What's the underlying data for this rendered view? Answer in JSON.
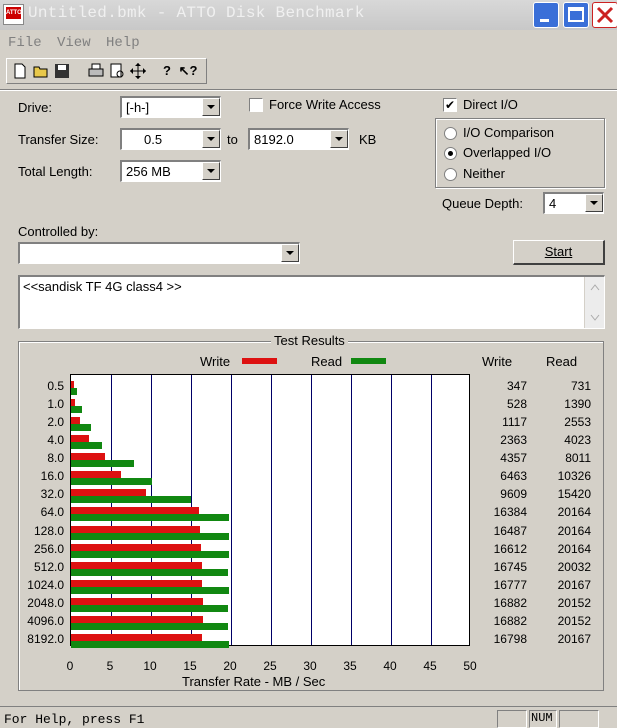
{
  "window": {
    "title": "Untitled.bmk - ATTO Disk Benchmark",
    "icon_text": "ATTO"
  },
  "menu": [
    "File",
    "View",
    "Help"
  ],
  "toolbar": [
    "new-icon",
    "open-icon",
    "save-icon",
    "print-icon",
    "print-preview-icon",
    "move-icon",
    "help-icon",
    "context-help-icon"
  ],
  "form": {
    "drive_label": "Drive:",
    "drive_value": "[-h-]",
    "transfer_size_label": "Transfer Size:",
    "transfer_from": "0.5",
    "to_label": "to",
    "transfer_to": "8192.0",
    "kb_label": "KB",
    "total_length_label": "Total Length:",
    "total_length_value": "256 MB",
    "force_write_label": "Force Write Access",
    "force_write_checked": false,
    "direct_io_label": "Direct I/O",
    "direct_io_checked": true,
    "io_comparison_label": "I/O Comparison",
    "overlapped_io_label": "Overlapped I/O",
    "neither_label": "Neither",
    "io_mode_selected": "overlapped",
    "queue_depth_label": "Queue Depth:",
    "queue_depth_value": "4",
    "controlled_by_label": "Controlled by:",
    "controlled_by_value": "",
    "start_label": "Start",
    "description": "<<sandisk TF 4G class4 >>"
  },
  "results": {
    "title": "Test Results",
    "write_legend": "Write",
    "read_legend": "Read",
    "write_header": "Write",
    "read_header": "Read",
    "xlabel": "Transfer Rate - MB / Sec"
  },
  "chart_data": {
    "type": "bar",
    "orientation": "horizontal",
    "title": "Test Results",
    "xlabel": "Transfer Rate - MB / Sec",
    "xlim": [
      0,
      50
    ],
    "xticks": [
      "0",
      "5",
      "10",
      "15",
      "20",
      "25",
      "30",
      "35",
      "40",
      "45",
      "50"
    ],
    "categories": [
      "0.5",
      "1.0",
      "2.0",
      "4.0",
      "8.0",
      "16.0",
      "32.0",
      "64.0",
      "128.0",
      "256.0",
      "512.0",
      "1024.0",
      "2048.0",
      "4096.0",
      "8192.0"
    ],
    "colors": {
      "write": "#dd1111",
      "read": "#118811"
    },
    "series": [
      {
        "name": "Write",
        "values": [
          347,
          528,
          1117,
          2363,
          4357,
          6463,
          9609,
          16384,
          16487,
          16612,
          16745,
          16777,
          16882,
          16882,
          16798
        ]
      },
      {
        "name": "Read",
        "values": [
          731,
          1390,
          2553,
          4023,
          8011,
          10326,
          15420,
          20164,
          20164,
          20164,
          20032,
          20167,
          20152,
          20152,
          20167
        ]
      }
    ]
  },
  "status": {
    "help_text": "For Help, press F1",
    "num": "NUM"
  }
}
